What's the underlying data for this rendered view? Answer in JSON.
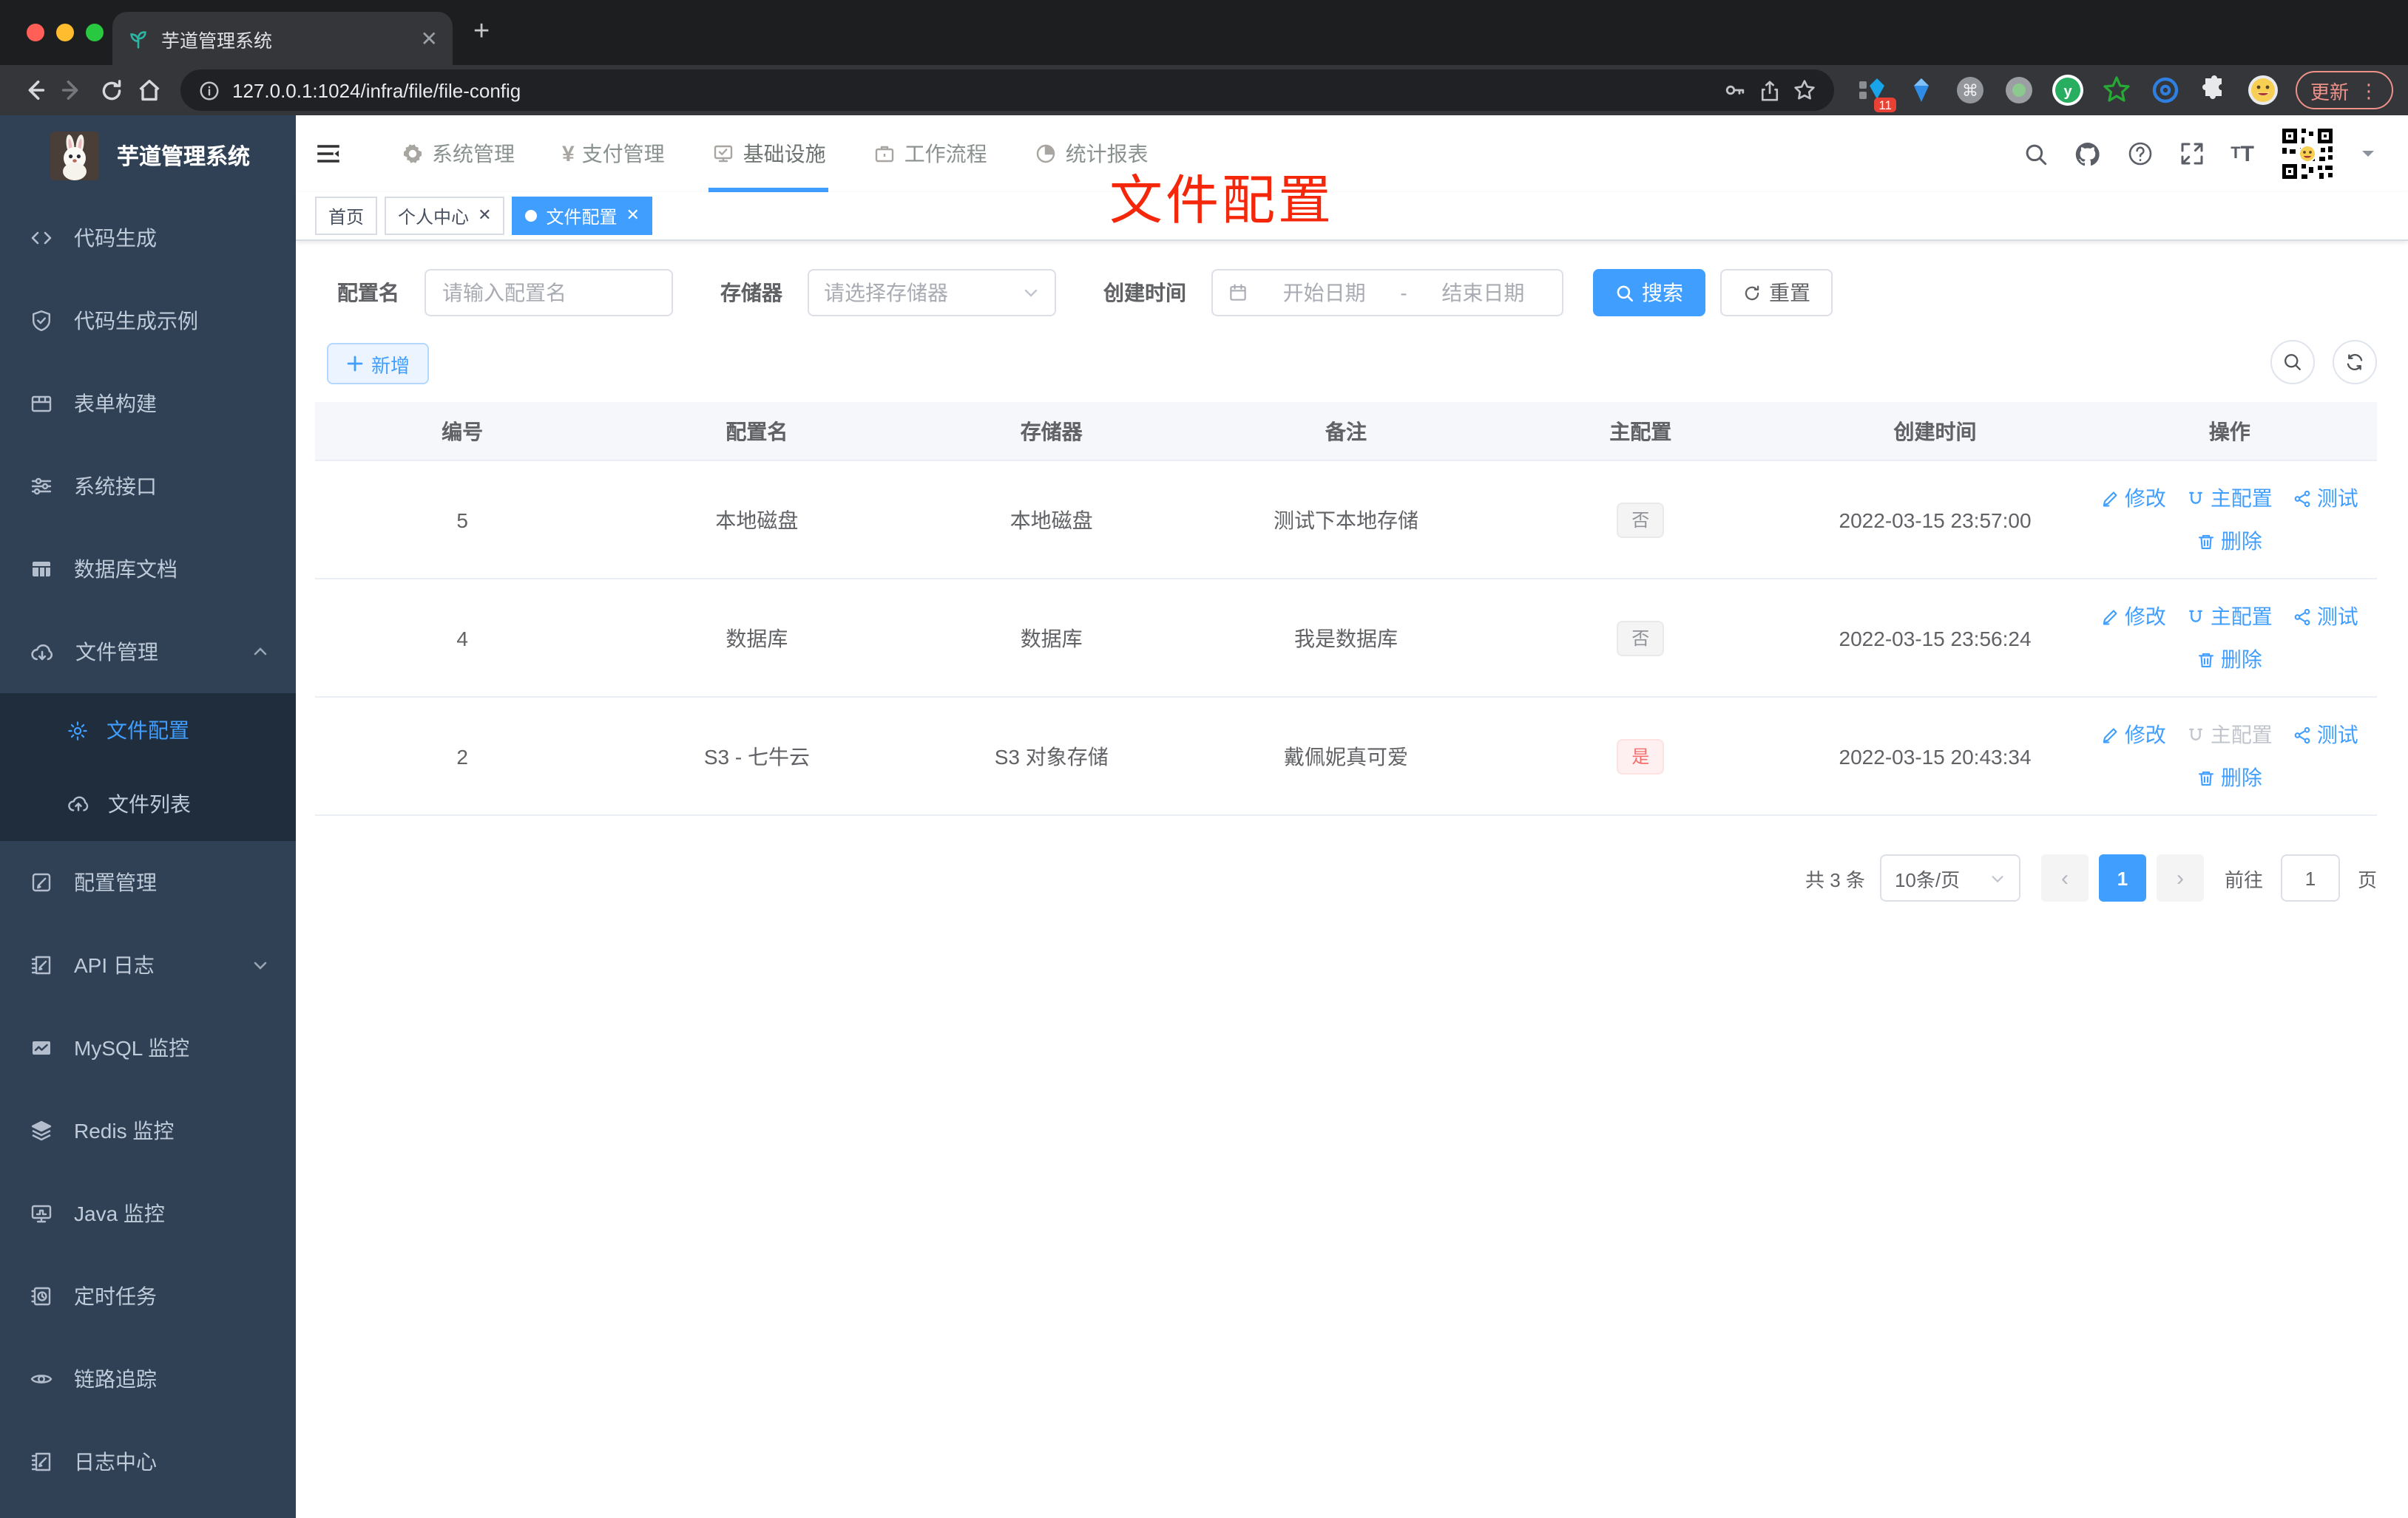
{
  "colors": {
    "accent": "#409EFF",
    "annotation_red": "#F5270B",
    "sidebar_bg": "#304156",
    "submenu_bg": "#1F2D3D",
    "danger": "#F56C6C"
  },
  "browser": {
    "tab_title": "芋道管理系统",
    "url": "127.0.0.1:1024/infra/file/file-config",
    "extension_badge": "11",
    "update_label": "更新",
    "kebab": "⋮"
  },
  "sidebar": {
    "title": "芋道管理系统",
    "items": [
      {
        "label": "代码生成",
        "icon": "code-icon"
      },
      {
        "label": "代码生成示例",
        "icon": "shield-check-icon"
      },
      {
        "label": "表单构建",
        "icon": "form-grid-icon"
      },
      {
        "label": "系统接口",
        "icon": "sliders-icon"
      },
      {
        "label": "数据库文档",
        "icon": "database-doc-icon"
      },
      {
        "label": "文件管理",
        "icon": "cloud-download-icon",
        "expanded": true,
        "children": [
          {
            "label": "文件配置",
            "icon": "gear-icon",
            "active": true
          },
          {
            "label": "文件列表",
            "icon": "cloud-upload-icon"
          }
        ]
      },
      {
        "label": "配置管理",
        "icon": "edit-square-icon"
      },
      {
        "label": "API 日志",
        "icon": "log-edit-icon",
        "collapsed": true
      },
      {
        "label": "MySQL 监控",
        "icon": "chart-monitor-icon"
      },
      {
        "label": "Redis 监控",
        "icon": "layers-icon"
      },
      {
        "label": "Java 监控",
        "icon": "java-monitor-icon"
      },
      {
        "label": "定时任务",
        "icon": "schedule-icon"
      },
      {
        "label": "链路追踪",
        "icon": "trace-eye-icon"
      },
      {
        "label": "日志中心",
        "icon": "log-center-icon"
      }
    ]
  },
  "topnav": {
    "items": [
      {
        "label": "系统管理",
        "icon": "gear-icon"
      },
      {
        "label": "支付管理",
        "icon": "yen-icon"
      },
      {
        "label": "基础设施",
        "icon": "infra-monitor-icon",
        "active": true
      },
      {
        "label": "工作流程",
        "icon": "briefcase-icon"
      },
      {
        "label": "统计报表",
        "icon": "pie-chart-icon"
      }
    ]
  },
  "tags": {
    "items": [
      {
        "label": "首页"
      },
      {
        "label": "个人中心",
        "closable": true
      },
      {
        "label": "文件配置",
        "closable": true,
        "active": true
      }
    ]
  },
  "annotation": {
    "text": "文件配置"
  },
  "filters": {
    "name_label": "配置名",
    "name_placeholder": "请输入配置名",
    "storage_label": "存储器",
    "storage_placeholder": "请选择存储器",
    "time_label": "创建时间",
    "start_placeholder": "开始日期",
    "range_separator": "-",
    "end_placeholder": "结束日期",
    "search_label": "搜索",
    "reset_label": "重置"
  },
  "toolbar": {
    "add_label": "新增"
  },
  "table": {
    "columns": [
      "编号",
      "配置名",
      "存储器",
      "备注",
      "主配置",
      "创建时间",
      "操作"
    ],
    "actions": {
      "edit": "修改",
      "master": "主配置",
      "test": "测试",
      "delete": "删除"
    },
    "rows": [
      {
        "id": "5",
        "name": "本地磁盘",
        "storage": "本地磁盘",
        "remark": "测试下本地存储",
        "master": "否",
        "master_type": "info",
        "created": "2022-03-15 23:57:00",
        "master_action_disabled": false
      },
      {
        "id": "4",
        "name": "数据库",
        "storage": "数据库",
        "remark": "我是数据库",
        "master": "否",
        "master_type": "info",
        "created": "2022-03-15 23:56:24",
        "master_action_disabled": false
      },
      {
        "id": "2",
        "name": "S3 - 七牛云",
        "storage": "S3 对象存储",
        "remark": "戴佩妮真可爱",
        "master": "是",
        "master_type": "danger",
        "created": "2022-03-15 20:43:34",
        "master_action_disabled": true
      }
    ]
  },
  "pagination": {
    "total_label": "共 3 条",
    "page_size": "10条/页",
    "current": "1",
    "goto_label": "前往",
    "goto_value": "1",
    "page_unit": "页"
  }
}
